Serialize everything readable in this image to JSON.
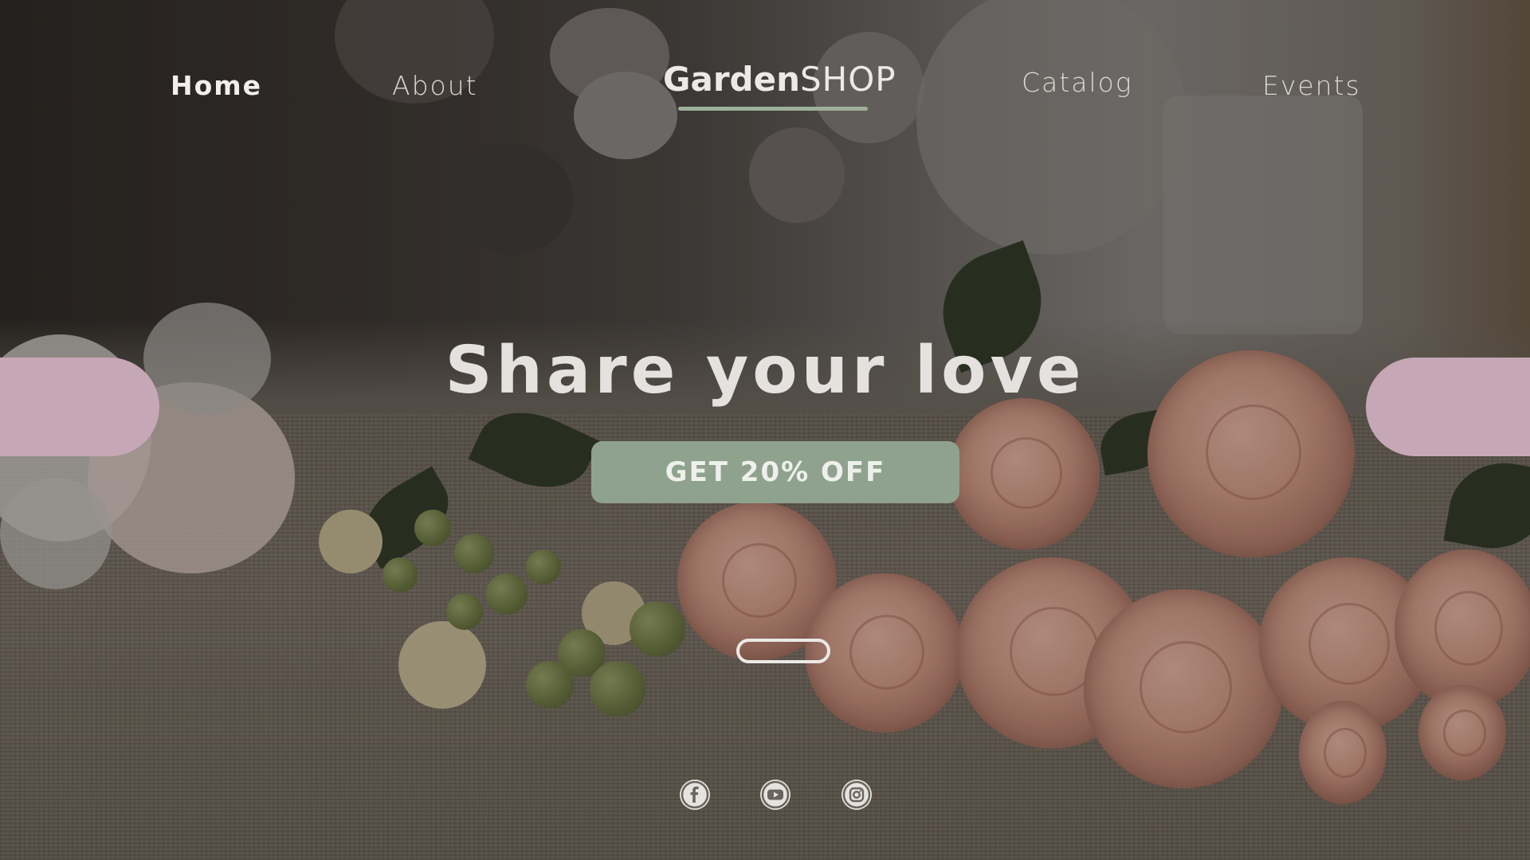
{
  "nav": {
    "home": "Home",
    "about": "About",
    "catalog": "Catalog",
    "events": "Events"
  },
  "logo": {
    "bold_part": "Garden",
    "light_part": "SHOP"
  },
  "hero": {
    "headline": "Share your love",
    "cta_label": "GET 20% OFF"
  },
  "social": {
    "icons": [
      "facebook-icon",
      "youtube-icon",
      "instagram-icon"
    ]
  },
  "colors": {
    "accent_green": "#8fa28d",
    "accent_pink": "#c6a7b6",
    "text_light": "#e4e1de",
    "underline": "#9eb09a"
  }
}
